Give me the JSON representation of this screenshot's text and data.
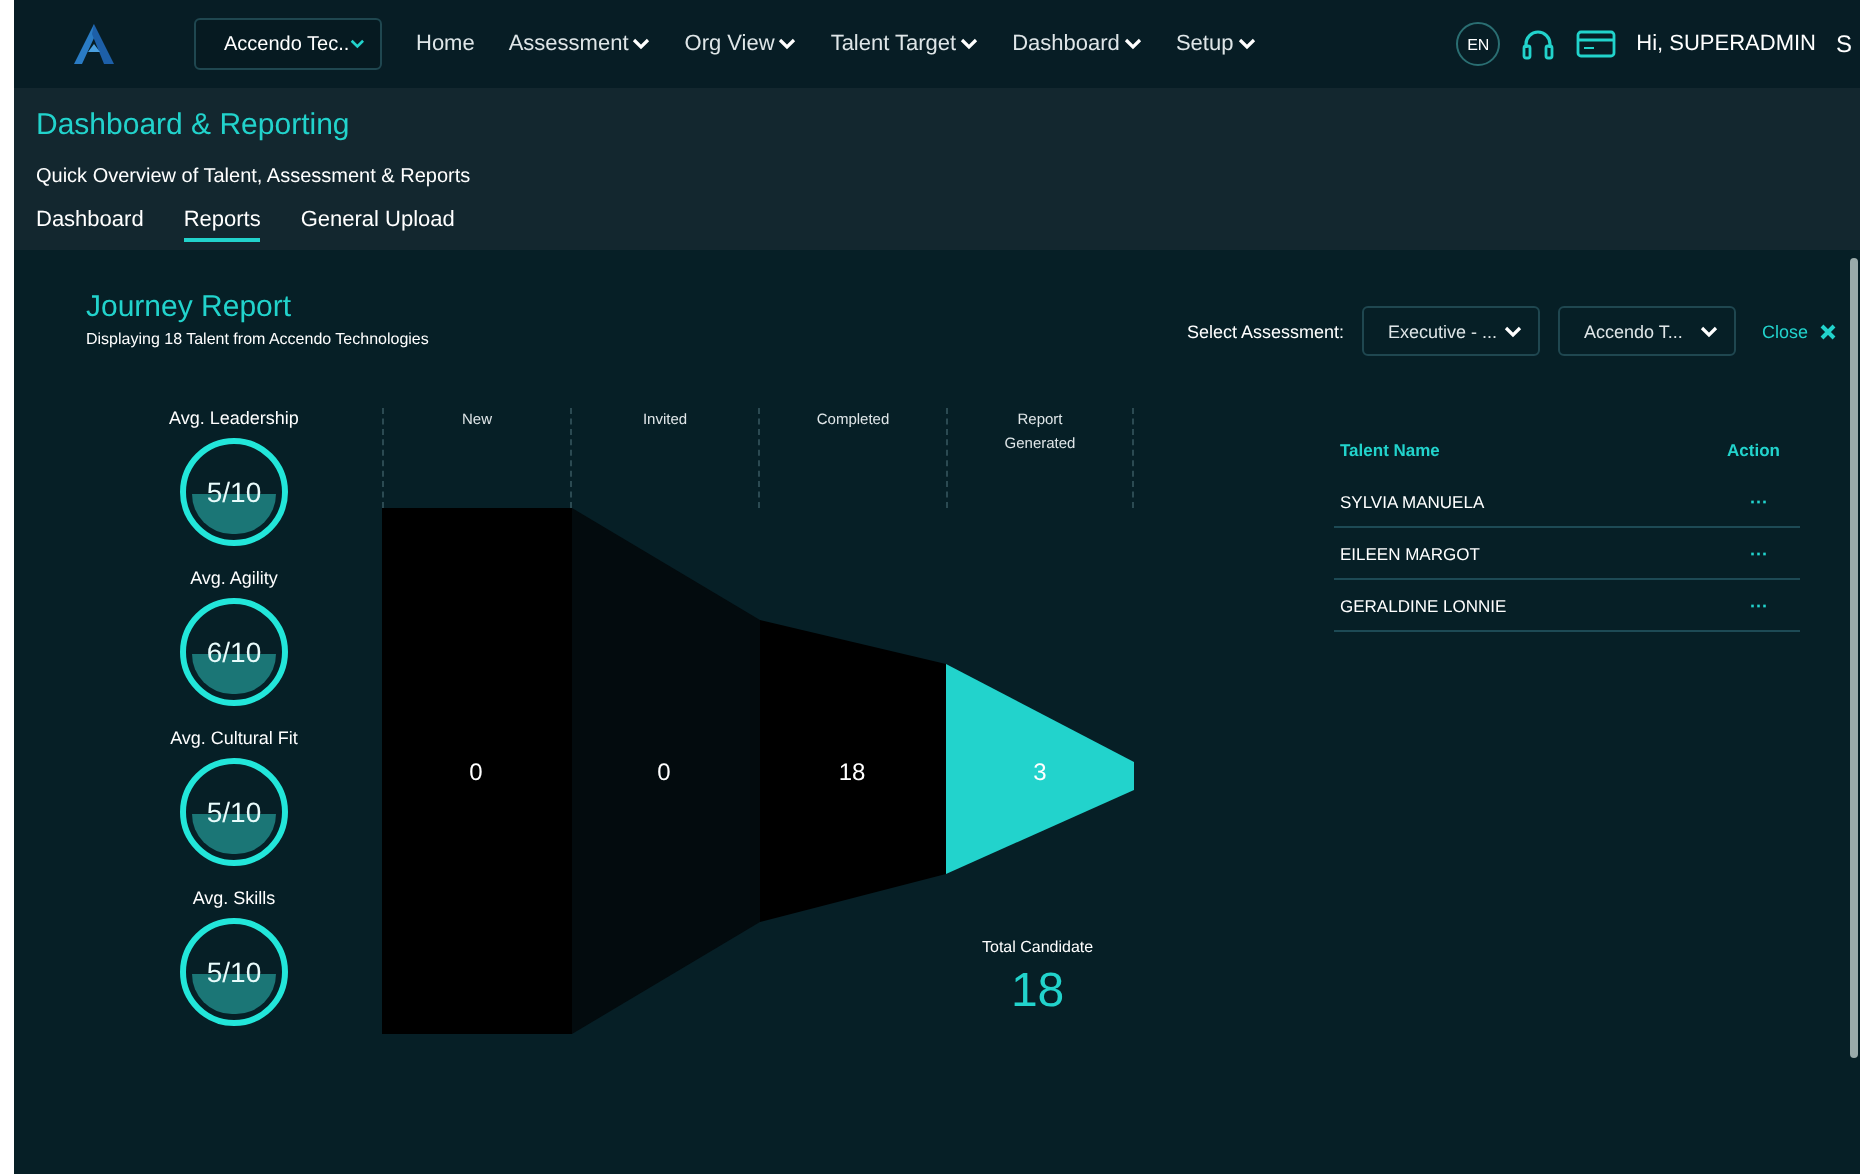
{
  "nav": {
    "org_select": "Accendo Tec..",
    "items": [
      {
        "label": "Home",
        "dropdown": false
      },
      {
        "label": "Assessment",
        "dropdown": true
      },
      {
        "label": "Org View",
        "dropdown": true
      },
      {
        "label": "Talent Target",
        "dropdown": true
      },
      {
        "label": "Dashboard",
        "dropdown": true
      },
      {
        "label": "Setup",
        "dropdown": true
      }
    ],
    "language": "EN",
    "greeting": "Hi, SUPERADMIN",
    "avatar_initial": "S"
  },
  "header": {
    "title": "Dashboard & Reporting",
    "subtitle": "Quick Overview of Talent, Assessment & Reports",
    "tabs": [
      {
        "label": "Dashboard",
        "selected": false
      },
      {
        "label": "Reports",
        "selected": true
      },
      {
        "label": "General Upload",
        "selected": false
      }
    ]
  },
  "report": {
    "title": "Journey Report",
    "subtitle": "Displaying 18 Talent from Accendo Technologies",
    "select_label": "Select Assessment:",
    "assessment_select": "Executive - ...",
    "company_select": "Accendo T...",
    "close": "Close",
    "gauges": [
      {
        "label": "Avg. Leadership",
        "reading": "5/10"
      },
      {
        "label": "Avg. Agility",
        "reading": "6/10"
      },
      {
        "label": "Avg. Cultural Fit",
        "reading": "5/10"
      },
      {
        "label": "Avg. Skills",
        "reading": "5/10"
      }
    ],
    "stages": [
      {
        "label": "New",
        "value": "0"
      },
      {
        "label": "Invited",
        "value": "0"
      },
      {
        "label": "Completed",
        "value": "18"
      },
      {
        "label": "Report Generated",
        "value": "3"
      }
    ],
    "total_label": "Total Candidate",
    "total": "18",
    "table": {
      "columns": [
        "Talent Name",
        "Action"
      ],
      "rows": [
        {
          "name": "SYLVIA MANUELA",
          "action": "···"
        },
        {
          "name": "EILEEN MARGOT",
          "action": "···"
        },
        {
          "name": "GERALDINE LONNIE",
          "action": "···"
        }
      ]
    }
  }
}
